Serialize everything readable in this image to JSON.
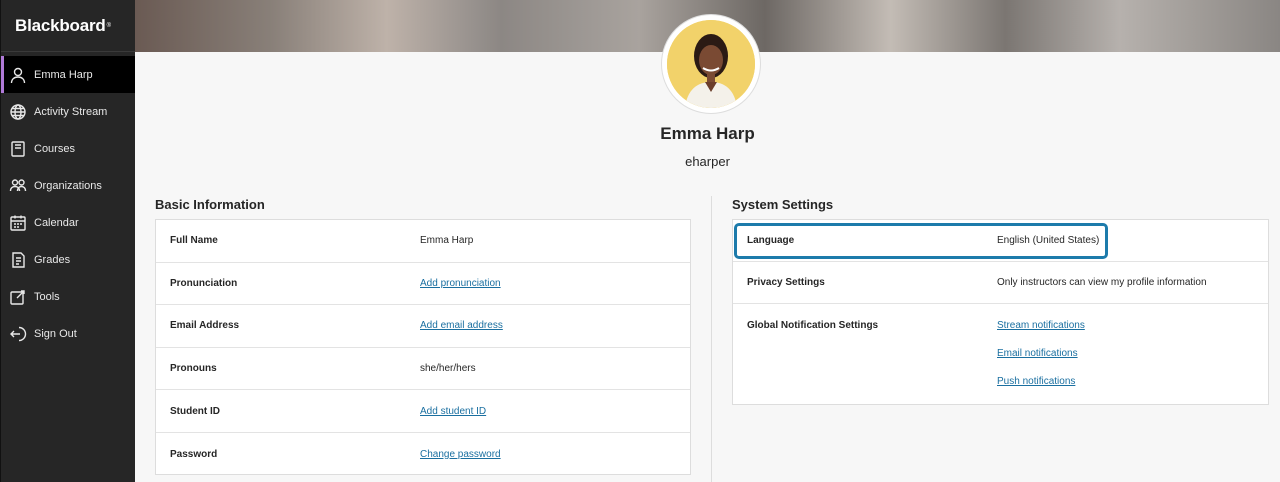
{
  "app": {
    "brand": "Blackboard",
    "brand_mark": "®"
  },
  "sidebar": {
    "items": [
      {
        "label": "Emma Harp",
        "icon": "user-icon",
        "active": true
      },
      {
        "label": "Activity Stream",
        "icon": "globe-icon"
      },
      {
        "label": "Courses",
        "icon": "book-icon"
      },
      {
        "label": "Organizations",
        "icon": "people-icon"
      },
      {
        "label": "Calendar",
        "icon": "calendar-icon"
      },
      {
        "label": "Grades",
        "icon": "grades-icon"
      },
      {
        "label": "Tools",
        "icon": "tools-icon"
      },
      {
        "label": "Sign Out",
        "icon": "sign-out-icon"
      }
    ]
  },
  "profile": {
    "name": "Emma Harp",
    "username": "eharper"
  },
  "basic_info": {
    "title": "Basic Information",
    "rows": [
      {
        "label": "Full Name",
        "value": "Emma Harp",
        "link": false
      },
      {
        "label": "Pronunciation",
        "value": "Add pronunciation",
        "link": true
      },
      {
        "label": "Email Address",
        "value": "Add email address",
        "link": true
      },
      {
        "label": "Pronouns",
        "value": "she/her/hers",
        "link": false
      },
      {
        "label": "Student ID",
        "value": "Add student ID",
        "link": true
      },
      {
        "label": "Password",
        "value": "Change password",
        "link": true
      }
    ]
  },
  "system_settings": {
    "title": "System Settings",
    "language": {
      "label": "Language",
      "value": "English (United States)"
    },
    "privacy": {
      "label": "Privacy Settings",
      "value": "Only instructors can view my profile information"
    },
    "notifications": {
      "label": "Global Notification Settings",
      "links": [
        "Stream notifications",
        "Email notifications",
        "Push notifications"
      ]
    }
  },
  "colors": {
    "accent": "#1d7bab",
    "link": "#1a6fa0",
    "sidebar_bg": "#262626",
    "active_indicator": "#b07ad8"
  }
}
